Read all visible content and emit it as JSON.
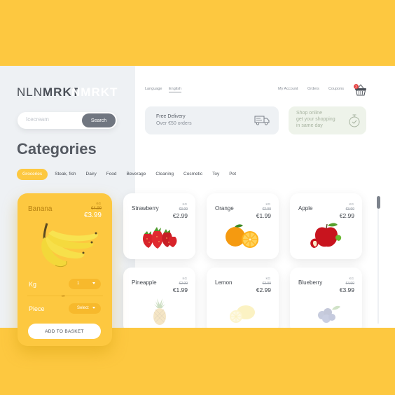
{
  "brand": {
    "logo_thin": "NLN",
    "logo_bold": "MRKT",
    "logo_ghost": "NMRKT"
  },
  "search": {
    "placeholder": "Icecream",
    "button_label": "Search"
  },
  "header": {
    "language_label": "Language",
    "language_value": "English",
    "nav": [
      "My Account",
      "Orders",
      "Coupons"
    ],
    "cart_count": "2"
  },
  "promos": {
    "delivery": {
      "line1": "Free Delivery",
      "line2": "Over €50 orders"
    },
    "shop_online": {
      "line1": "Shop online",
      "line2": "get your shopping",
      "line3": "in same day"
    }
  },
  "categories": {
    "title": "Categories",
    "tabs": [
      "Groceries",
      "Steak, fish",
      "Dairy",
      "Food",
      "Beverage",
      "Cleaning",
      "Cosmetic",
      "Toy",
      "Pet"
    ],
    "active_tab": "Groceries"
  },
  "featured": {
    "name": "Banana",
    "unit": "KG",
    "old_price": "€4.99",
    "price": "€3.99",
    "kg_label": "Kg",
    "kg_value": "1",
    "or_label": "or",
    "piece_label": "Piece",
    "piece_value": "Select",
    "add_button": "ADD TO BASKET"
  },
  "products": [
    {
      "name": "Strawberry",
      "unit": "KG",
      "old_price": "€3.99",
      "price": "€2.99"
    },
    {
      "name": "Orange",
      "unit": "KG",
      "old_price": "€2.99",
      "price": "€1.99"
    },
    {
      "name": "Apple",
      "unit": "KG",
      "old_price": "€3.99",
      "price": "€2.99"
    },
    {
      "name": "Pineapple",
      "unit": "KG",
      "old_price": "€2.99",
      "price": "€1.99"
    },
    {
      "name": "Lemon",
      "unit": "KG",
      "old_price": "€3.99",
      "price": "€2.99"
    },
    {
      "name": "Blueberry",
      "unit": "KG",
      "old_price": "€4.99",
      "price": "€3.99"
    }
  ],
  "colors": {
    "accent": "#fdc840",
    "dark_text": "#4a4f57",
    "search_button": "#707680"
  }
}
